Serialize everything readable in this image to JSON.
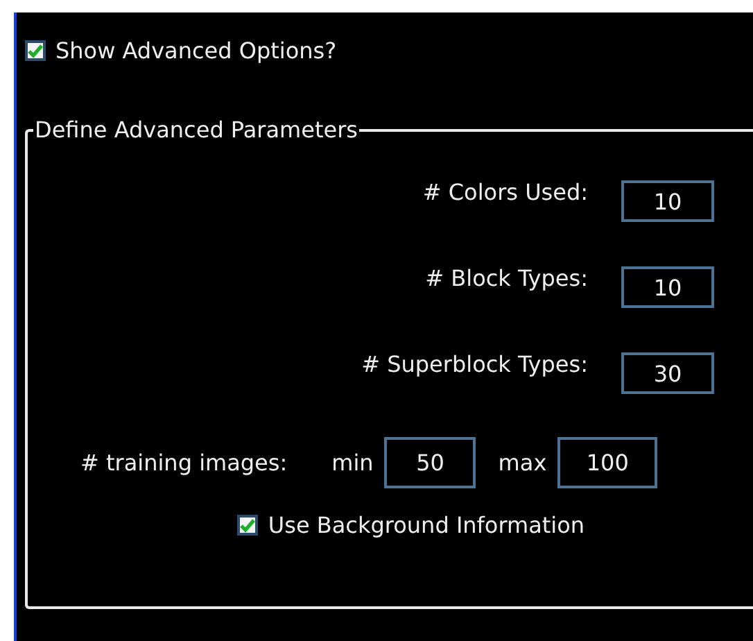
{
  "show_advanced": {
    "label": "Show Advanced Options?",
    "checked": true
  },
  "group": {
    "title": "Define Advanced Parameters",
    "params": [
      {
        "label": "# Colors Used:",
        "value": "10"
      },
      {
        "label": "# Block Types:",
        "value": "10"
      },
      {
        "label": "# Superblock Types:",
        "value": "30"
      }
    ],
    "training": {
      "label": "# training images:",
      "min_label": "min",
      "min_value": "50",
      "max_label": "max",
      "max_value": "100"
    },
    "use_background": {
      "label": "Use Background Information",
      "checked": true
    }
  }
}
